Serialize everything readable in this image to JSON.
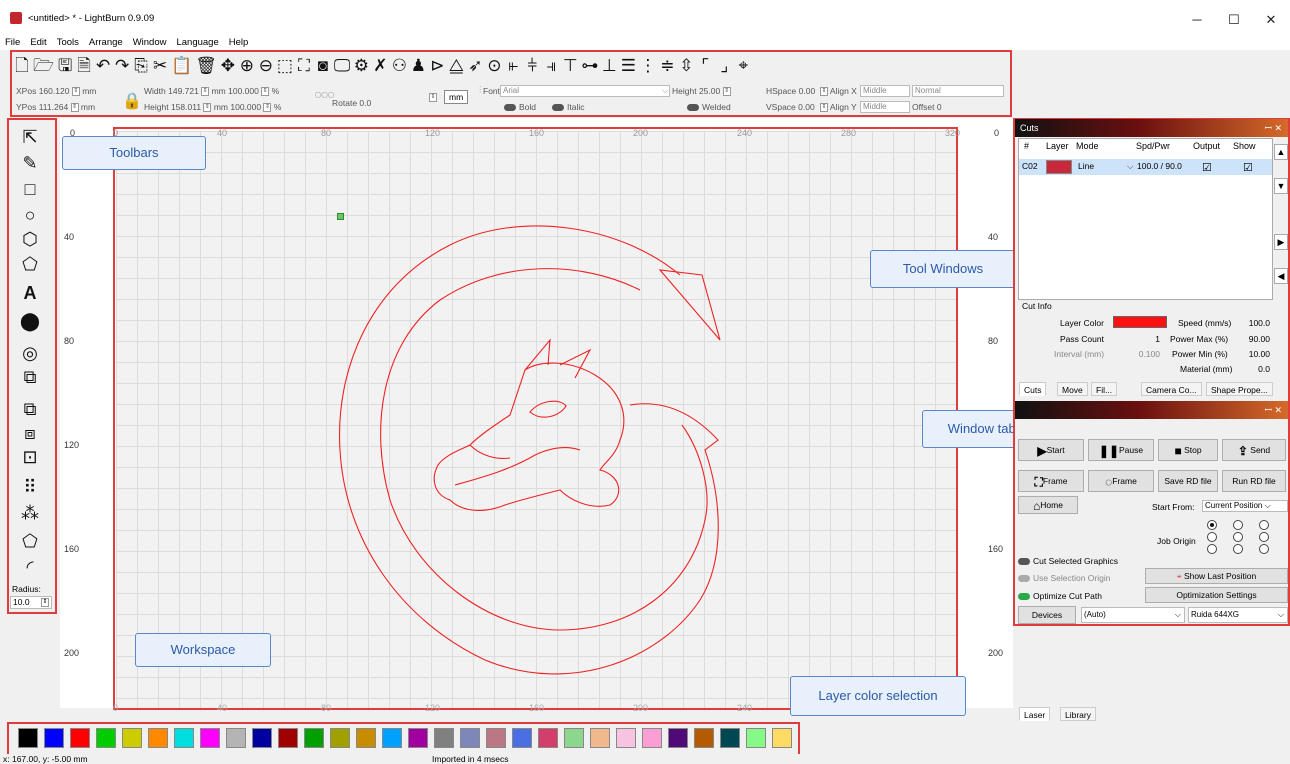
{
  "window": {
    "title": "<untitled> * - LightBurn 0.9.09",
    "minimize": "─",
    "maximize": "☐",
    "close": "✕"
  },
  "menu": [
    "File",
    "Edit",
    "Tools",
    "Arrange",
    "Window",
    "Language",
    "Help"
  ],
  "toolbar_icons": [
    "new-file",
    "open",
    "save",
    "save-as",
    "undo",
    "redo",
    "copy",
    "cut",
    "paste",
    "delete",
    "move",
    "zoom-in",
    "zoom-out",
    "zoom-fit",
    "select",
    "camera",
    "monitor",
    "settings",
    "tools"
  ],
  "props": {
    "xpos_label": "XPos",
    "xpos": "160.120",
    "ypos_label": "YPos",
    "ypos": "111.264",
    "unit": "mm",
    "width_label": "Width",
    "width": "149.721",
    "height_label": "Height",
    "height": "158.011",
    "pct_w": "100.000",
    "pct_h": "100.000",
    "pct": "%",
    "rotate_label": "Rotate",
    "rotate": "0.0",
    "mm_button": "mm",
    "font_label": "Font",
    "font": "Arial",
    "height2_label": "Height",
    "height2": "25.00",
    "hspace_label": "HSpace",
    "hspace": "0.00",
    "vspace_label": "VSpace",
    "vspace": "0.00",
    "alignx_label": "Align X",
    "alignx": "Middle",
    "aligny_label": "Align Y",
    "aligny": "Middle",
    "normal": "Normal",
    "offset_label": "Offset",
    "offset": "0",
    "bold": "Bold",
    "italic": "Italic",
    "welded": "Welded"
  },
  "left_tools": {
    "radius_label": "Radius:",
    "radius": "10.0"
  },
  "rulers": {
    "x": [
      "0",
      "40",
      "80",
      "120",
      "160",
      "200",
      "240",
      "280",
      "320"
    ],
    "y": [
      "0",
      "40",
      "80",
      "120",
      "160",
      "200"
    ],
    "bottom": [
      "0",
      "40",
      "80",
      "120",
      "160",
      "200",
      "240"
    ]
  },
  "callouts": {
    "toolbars": "Toolbars",
    "tool_windows": "Tool Windows",
    "window_tabs": "Window tabs",
    "workspace": "Workspace",
    "layer_color": "Layer color selection"
  },
  "cuts": {
    "title": "Cuts",
    "headers": [
      "#",
      "Layer",
      "Mode",
      "Spd/Pwr",
      "Output",
      "Show"
    ],
    "row": {
      "id": "C02",
      "mode": "Line",
      "spdpwr": "100.0 / 90.0",
      "output": "☑",
      "show": "☑"
    },
    "layer_color": "#c8283c"
  },
  "cut_info": {
    "title": "Cut Info",
    "layer_color_label": "Layer Color",
    "pass_count_label": "Pass Count",
    "pass_count": "1",
    "interval_label": "Interval (mm)",
    "interval": "0.100",
    "speed_label": "Speed (mm/s)",
    "speed": "100.0",
    "power_max_label": "Power Max (%)",
    "power_max": "90.00",
    "power_min_label": "Power Min (%)",
    "power_min": "10.00",
    "material_label": "Material (mm)",
    "material": "0.0"
  },
  "tabs": [
    "Cuts",
    "Move",
    "Fil...",
    "Camera Co...",
    "Shape Prope..."
  ],
  "laser": {
    "start": "Start",
    "pause": "Pause",
    "stop": "Stop",
    "send": "Send",
    "frame1": "Frame",
    "frame2": "Frame",
    "save_rd": "Save RD file",
    "run_rd": "Run RD file",
    "home": "Home",
    "start_from_label": "Start From:",
    "start_from": "Current Position",
    "job_origin": "Job Origin",
    "cut_selected": "Cut Selected Graphics",
    "use_selection_origin": "Use Selection Origin",
    "optimize": "Optimize Cut Path",
    "show_last": "Show Last Position",
    "opt_settings": "Optimization Settings",
    "devices": "Devices",
    "auto": "(Auto)",
    "device": "Ruida 644XG"
  },
  "bottom_tabs": [
    "Laser",
    "Library"
  ],
  "palette": [
    "#000000",
    "#0000ff",
    "#ff0000",
    "#00cc00",
    "#cccc00",
    "#ff8800",
    "#00dddd",
    "#ff00ff",
    "#b4b4b4",
    "#0000a0",
    "#a00000",
    "#00a000",
    "#a0a000",
    "#c88c00",
    "#00a0ff",
    "#a000a0",
    "#808080",
    "#7d87b9",
    "#bb7784",
    "#4a6fe3",
    "#d33f6a",
    "#8cd78c",
    "#f0b98d",
    "#f6c4e1",
    "#fa9ed4",
    "#500a78",
    "#b45a00",
    "#004754",
    "#86fa88",
    "#ffdb66"
  ],
  "status": {
    "coords": "x: 167.00, y: -5.00 mm",
    "message": "Imported in 4 msecs"
  }
}
